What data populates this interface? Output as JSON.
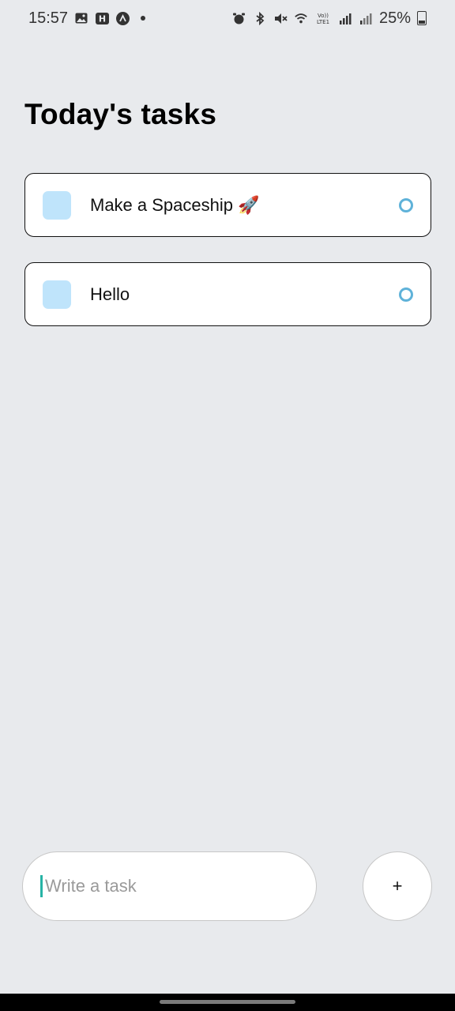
{
  "status_bar": {
    "time": "15:57",
    "battery": "25%",
    "icons_left": [
      "gallery-icon",
      "h-badge-icon",
      "alert-icon",
      "dot-icon"
    ],
    "icons_right": [
      "alarm-icon",
      "bluetooth-icon",
      "mute-icon",
      "wifi-icon",
      "volte-icon",
      "signal-icon",
      "signal-icon-2",
      "battery-icon"
    ]
  },
  "page": {
    "title": "Today's tasks"
  },
  "tasks": [
    {
      "text": "Make a Spaceship 🚀"
    },
    {
      "text": "Hello"
    }
  ],
  "input": {
    "placeholder": "Write a task",
    "value": ""
  },
  "add_button": {
    "label": "+"
  },
  "colors": {
    "background": "#e8eaed",
    "task_square": "#bfe4fb",
    "task_status_ring": "#5fb2d9",
    "caret": "#27b3a5"
  }
}
